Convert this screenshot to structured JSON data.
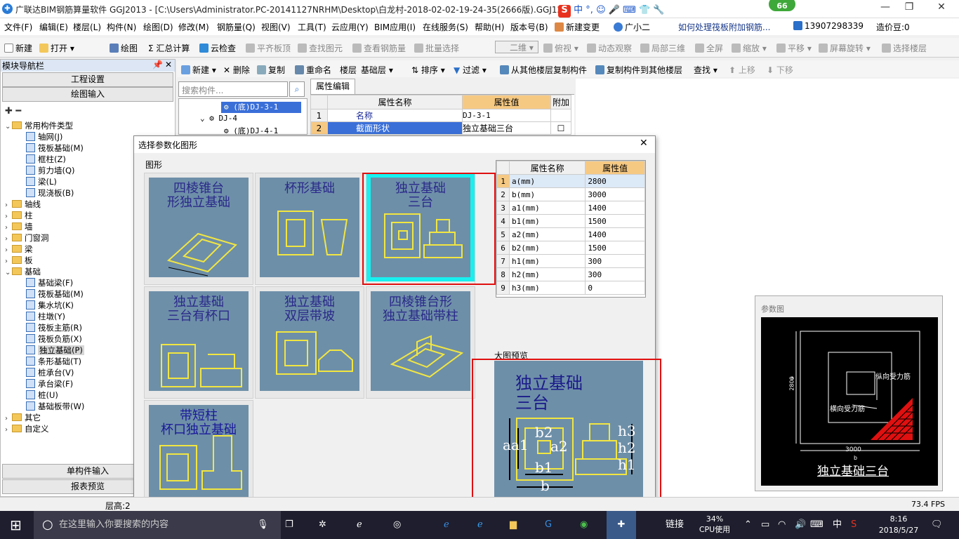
{
  "window": {
    "title": "广联达BIM钢筋算量软件 GGJ2013 - [C:\\Users\\Administrator.PC-20141127NRHM\\Desktop\\白龙村-2018-02-02-19-24-35(2666版).GGJ12]",
    "badge": "66",
    "ime_label": "中",
    "min": "—",
    "max": "❐",
    "close": "✕"
  },
  "menu": [
    "文件(F)",
    "编辑(E)",
    "楼层(L)",
    "构件(N)",
    "绘图(D)",
    "修改(M)",
    "钢筋量(Q)",
    "视图(V)",
    "工具(T)",
    "云应用(Y)",
    "BIM应用(I)",
    "在线服务(S)",
    "帮助(H)",
    "版本号(B)",
    "新建变更",
    "广小二",
    "如何处理筏板附加钢筋...",
    "13907298339",
    "造价豆:0"
  ],
  "toolbar": {
    "new": "新建",
    "open": "打开",
    "draw": "绘图",
    "sum": "汇总计算",
    "cloud_check": "云检查",
    "flush_top": "平齐板顶",
    "find_elem": "查找图元",
    "view_rebar": "查看钢筋量",
    "batch_select": "批量选择",
    "view_2d": "二维",
    "top_view": "俯视",
    "dyn_view": "动态观察",
    "local_3d": "局部三维",
    "fullscreen": "全屏",
    "zoom": "缩放",
    "pan": "平移",
    "rotate": "屏幕旋转",
    "select_floor": "选择楼层"
  },
  "left_panel": {
    "header": "模块导航栏",
    "btn_project": "工程设置",
    "btn_draw": "绘图输入",
    "btn_single": "单构件输入",
    "btn_report": "报表预览",
    "tree": [
      {
        "label": "常用构件类型",
        "level": 0,
        "type": "folder",
        "open": true
      },
      {
        "label": "轴网(J)",
        "level": 1
      },
      {
        "label": "筏板基础(M)",
        "level": 1
      },
      {
        "label": "框柱(Z)",
        "level": 1
      },
      {
        "label": "剪力墙(Q)",
        "level": 1
      },
      {
        "label": "梁(L)",
        "level": 1
      },
      {
        "label": "现浇板(B)",
        "level": 1
      },
      {
        "label": "轴线",
        "level": 0,
        "type": "folder"
      },
      {
        "label": "柱",
        "level": 0,
        "type": "folder"
      },
      {
        "label": "墙",
        "level": 0,
        "type": "folder"
      },
      {
        "label": "门窗洞",
        "level": 0,
        "type": "folder"
      },
      {
        "label": "梁",
        "level": 0,
        "type": "folder"
      },
      {
        "label": "板",
        "level": 0,
        "type": "folder"
      },
      {
        "label": "基础",
        "level": 0,
        "type": "folder",
        "open": true
      },
      {
        "label": "基础梁(F)",
        "level": 1
      },
      {
        "label": "筏板基础(M)",
        "level": 1
      },
      {
        "label": "集水坑(K)",
        "level": 1
      },
      {
        "label": "柱墩(Y)",
        "level": 1
      },
      {
        "label": "筏板主筋(R)",
        "level": 1
      },
      {
        "label": "筏板负筋(X)",
        "level": 1
      },
      {
        "label": "独立基础(P)",
        "level": 1,
        "selected": true
      },
      {
        "label": "条形基础(T)",
        "level": 1
      },
      {
        "label": "桩承台(V)",
        "level": 1
      },
      {
        "label": "承台梁(F)",
        "level": 1
      },
      {
        "label": "桩(U)",
        "level": 1
      },
      {
        "label": "基础板带(W)",
        "level": 1
      },
      {
        "label": "其它",
        "level": 0,
        "type": "folder"
      },
      {
        "label": "自定义",
        "level": 0,
        "type": "folder"
      }
    ]
  },
  "toolbar2": {
    "new": "新建",
    "delete": "删除",
    "copy": "复制",
    "rename": "重命名",
    "floor": "楼层",
    "floor_val": "基础层",
    "sort": "排序",
    "filter": "过滤",
    "copy_from": "从其他楼层复制构件",
    "copy_to": "复制构件到其他楼层",
    "find": "查找",
    "up": "上移",
    "down": "下移"
  },
  "search": {
    "placeholder": "搜索构件..."
  },
  "component_list": [
    "(底)DJ-3-1",
    "DJ-4",
    "(底)DJ-4-1"
  ],
  "prop_edit": {
    "tab": "属性编辑",
    "col_name": "属性名称",
    "col_value": "属性值",
    "col_extra": "附加",
    "rows": [
      [
        "1",
        "名称",
        "DJ-3-1"
      ],
      [
        "2",
        "截面形状",
        "独立基础三台"
      ]
    ]
  },
  "dialog": {
    "title": "选择参数化图形",
    "group_label": "图形",
    "preview_label": "大图预览",
    "shapes": [
      {
        "title": "四棱锥台\n形独立基础"
      },
      {
        "title": "杯形基础"
      },
      {
        "title": "独立基础\n三台"
      },
      {
        "title": "独立基础\n三台有杯口"
      },
      {
        "title": "独立基础\n双层带坡"
      },
      {
        "title": "四棱锥台形\n独立基础带柱"
      },
      {
        "title": "带短柱\n杯口独立基础"
      }
    ],
    "table": {
      "col_name": "属性名称",
      "col_value": "属性值",
      "rows": [
        [
          "1",
          "a(mm)",
          "2800"
        ],
        [
          "2",
          "b(mm)",
          "3000"
        ],
        [
          "3",
          "a1(mm)",
          "1400"
        ],
        [
          "4",
          "b1(mm)",
          "1500"
        ],
        [
          "5",
          "a2(mm)",
          "1400"
        ],
        [
          "6",
          "b2(mm)",
          "1500"
        ],
        [
          "7",
          "h1(mm)",
          "300"
        ],
        [
          "8",
          "h2(mm)",
          "300"
        ],
        [
          "9",
          "h3(mm)",
          "0"
        ]
      ]
    },
    "preview_title": "独立基础\n三台",
    "dim_labels": {
      "a": "a",
      "a1": "a1",
      "b": "b",
      "b1": "b1",
      "b2": "b2",
      "a2": "a2",
      "h1": "h1",
      "h2": "h2",
      "h3": "h3"
    }
  },
  "param_image": {
    "label": "参数图",
    "caption": "独立基础三台",
    "dim_a": "2800",
    "dim_b": "3000",
    "note_long": "纵向受力筋",
    "note_trans": "横向受力筋",
    "a_letter": "a",
    "b_letter": "b"
  },
  "status": {
    "floor": "层高:2",
    "fps": "73.4 FPS"
  },
  "taskbar": {
    "search_placeholder": "在这里输入你要搜索的内容",
    "link": "链接",
    "cpu_pct": "34%",
    "cpu_label": "CPU使用",
    "ime": "中",
    "time": "8:16",
    "date": "2018/5/27"
  }
}
